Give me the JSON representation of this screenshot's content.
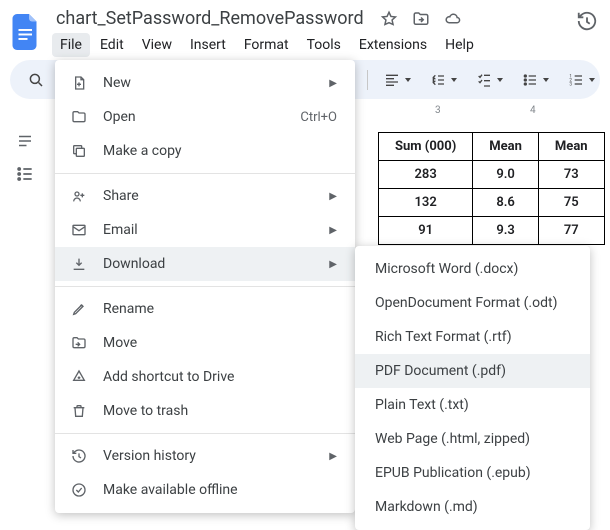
{
  "doc_title": "chart_SetPassword_RemovePassword",
  "menubar": [
    "File",
    "Edit",
    "View",
    "Insert",
    "Format",
    "Tools",
    "Extensions",
    "Help"
  ],
  "toolbar_icons": [
    "search",
    "align",
    "line-spacing",
    "checklist",
    "bulleted-list",
    "numbered-list"
  ],
  "ruler_marks": [
    "3",
    "4"
  ],
  "table": {
    "headers": [
      "Sum (000)",
      "Mean",
      "Mean"
    ],
    "rows": [
      [
        "283",
        "9.0",
        "73"
      ],
      [
        "132",
        "8.6",
        "75"
      ],
      [
        "91",
        "9.3",
        "77"
      ]
    ]
  },
  "file_menu": {
    "new": "New",
    "open": "Open",
    "open_shortcut": "Ctrl+O",
    "copy": "Make a copy",
    "share": "Share",
    "email": "Email",
    "download": "Download",
    "rename": "Rename",
    "move": "Move",
    "add_shortcut": "Add shortcut to Drive",
    "trash": "Move to trash",
    "version": "Version history",
    "offline": "Make available offline"
  },
  "download_submenu": [
    "Microsoft Word (.docx)",
    "OpenDocument Format (.odt)",
    "Rich Text Format (.rtf)",
    "PDF Document (.pdf)",
    "Plain Text (.txt)",
    "Web Page (.html, zipped)",
    "EPUB Publication (.epub)",
    "Markdown (.md)"
  ],
  "download_highlight_index": 3
}
